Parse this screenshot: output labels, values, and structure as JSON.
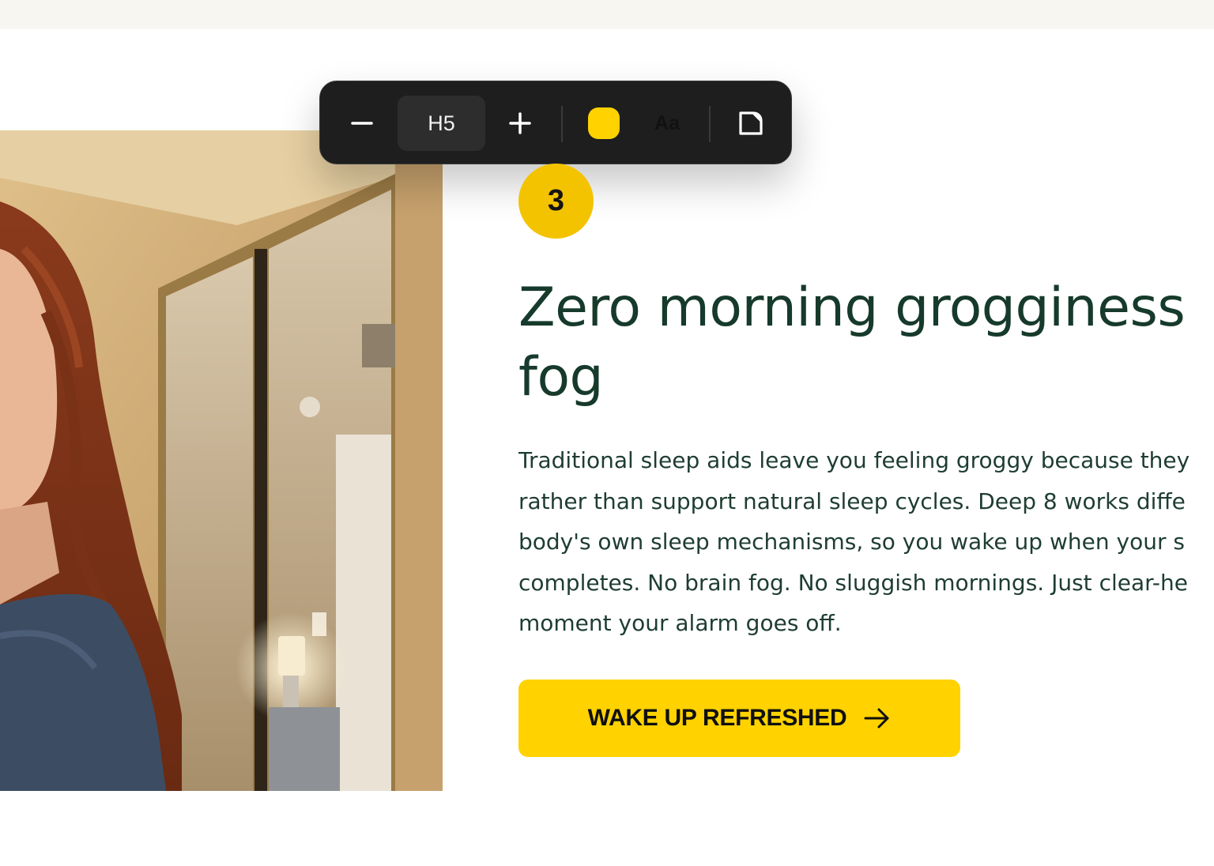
{
  "toolbar": {
    "decrease_icon": "minus-icon",
    "heading_level": "H5",
    "increase_icon": "plus-icon",
    "text_color": "#ffd200",
    "font_label": "Aa",
    "copy_icon": "copy-icon"
  },
  "step": {
    "number": "3"
  },
  "section": {
    "heading_lines": [
      "Zero morning grogginess",
      "fog"
    ],
    "body_lines": [
      "Traditional sleep aids leave you feeling groggy because they",
      "rather than support natural sleep cycles. Deep 8 works diffe",
      "body's own sleep mechanisms, so you wake up when your s",
      "completes. No brain fog. No sluggish mornings. Just clear-he",
      "moment your alarm goes off."
    ],
    "cta_label": "WAKE UP REFRESHED",
    "cta_icon": "arrow-right-icon"
  },
  "colors": {
    "accent": "#ffd200",
    "heading": "#163a2b",
    "badge": "#f3c300"
  }
}
